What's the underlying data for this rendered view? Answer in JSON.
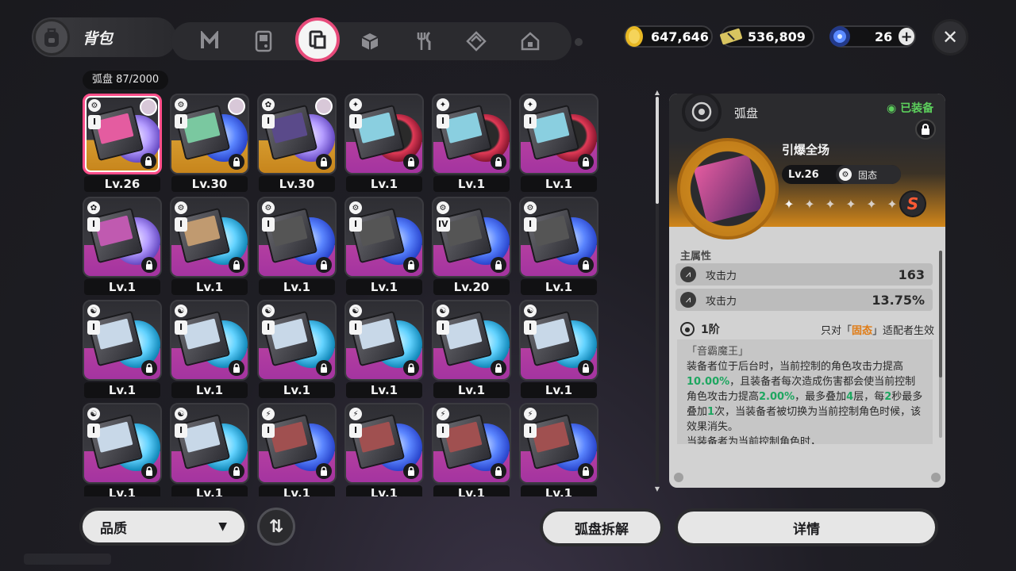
{
  "header": {
    "title": "背包",
    "tabs": [
      {
        "name": "tab-drive",
        "icon": "n-logo-icon"
      },
      {
        "name": "tab-device",
        "icon": "gameboy-icon"
      },
      {
        "name": "tab-disc",
        "icon": "disc-icon",
        "active": true
      },
      {
        "name": "tab-box",
        "icon": "cube-icon"
      },
      {
        "name": "tab-food",
        "icon": "fork-knife-icon"
      },
      {
        "name": "tab-material",
        "icon": "diamond-icon"
      },
      {
        "name": "tab-home",
        "icon": "house-icon"
      }
    ],
    "currencies": [
      {
        "name": "gold-currency",
        "icon": "coin-icon",
        "value": "647,646",
        "color": "#e8b824"
      },
      {
        "name": "ticket-currency",
        "icon": "ticket-icon",
        "value": "536,809",
        "color": "#d8c460"
      },
      {
        "name": "energy-currency",
        "icon": "energy-orb-icon",
        "value": "26",
        "color": "#3a6ae0"
      }
    ]
  },
  "inventory": {
    "count_label": "弧盘 87/2000",
    "cards": [
      {
        "attr": "⚙",
        "rank": "I",
        "level": "Lv.26",
        "quality": "gold",
        "selected": true,
        "avatar": true,
        "disc": "purple",
        "art": "#e45ca0"
      },
      {
        "attr": "⚙",
        "rank": "I",
        "level": "Lv.30",
        "quality": "gold",
        "avatar": true,
        "disc": "blue",
        "art": "#7ac8a0"
      },
      {
        "attr": "✿",
        "rank": "I",
        "level": "Lv.30",
        "quality": "gold",
        "avatar": true,
        "disc": "purple",
        "art": "#5a4a8a"
      },
      {
        "attr": "✦",
        "rank": "I",
        "level": "Lv.1",
        "quality": "purple",
        "disc": "red",
        "art": "#8acfe0"
      },
      {
        "attr": "✦",
        "rank": "I",
        "level": "Lv.1",
        "quality": "purple",
        "disc": "red",
        "art": "#8acfe0"
      },
      {
        "attr": "✦",
        "rank": "I",
        "level": "Lv.1",
        "quality": "purple",
        "disc": "red",
        "art": "#8acfe0"
      },
      {
        "attr": "✿",
        "rank": "I",
        "level": "Lv.1",
        "quality": "purple",
        "disc": "purple",
        "art": "#c05ab0"
      },
      {
        "attr": "⚙",
        "rank": "I",
        "level": "Lv.1",
        "quality": "purple",
        "disc": "teal",
        "art": "#c09a70"
      },
      {
        "attr": "⚙",
        "rank": "I",
        "level": "Lv.1",
        "quality": "purple",
        "disc": "blue",
        "art": "#555"
      },
      {
        "attr": "⚙",
        "rank": "I",
        "level": "Lv.1",
        "quality": "purple",
        "disc": "blue",
        "art": "#555"
      },
      {
        "attr": "⚙",
        "rank": "IV",
        "level": "Lv.20",
        "quality": "purple",
        "disc": "blue",
        "art": "#555"
      },
      {
        "attr": "⚙",
        "rank": "I",
        "level": "Lv.1",
        "quality": "purple",
        "disc": "blue",
        "art": "#555"
      },
      {
        "attr": "☯",
        "rank": "I",
        "level": "Lv.1",
        "quality": "purple",
        "disc": "teal",
        "art": "#c8d8e8"
      },
      {
        "attr": "☯",
        "rank": "I",
        "level": "Lv.1",
        "quality": "purple",
        "disc": "teal",
        "art": "#c8d8e8"
      },
      {
        "attr": "☯",
        "rank": "I",
        "level": "Lv.1",
        "quality": "purple",
        "disc": "teal",
        "art": "#c8d8e8"
      },
      {
        "attr": "☯",
        "rank": "I",
        "level": "Lv.1",
        "quality": "purple",
        "disc": "teal",
        "art": "#c8d8e8"
      },
      {
        "attr": "☯",
        "rank": "I",
        "level": "Lv.1",
        "quality": "purple",
        "disc": "teal",
        "art": "#c8d8e8"
      },
      {
        "attr": "☯",
        "rank": "I",
        "level": "Lv.1",
        "quality": "purple",
        "disc": "teal",
        "art": "#c8d8e8"
      },
      {
        "attr": "☯",
        "rank": "I",
        "level": "Lv.1",
        "quality": "purple",
        "disc": "teal",
        "art": "#c8d8e8"
      },
      {
        "attr": "☯",
        "rank": "I",
        "level": "Lv.1",
        "quality": "purple",
        "disc": "teal",
        "art": "#c8d8e8"
      },
      {
        "attr": "⚡",
        "rank": "I",
        "level": "Lv.1",
        "quality": "purple",
        "disc": "blue",
        "art": "#a05050"
      },
      {
        "attr": "⚡",
        "rank": "I",
        "level": "Lv.1",
        "quality": "purple",
        "disc": "blue",
        "art": "#a05050"
      },
      {
        "attr": "⚡",
        "rank": "I",
        "level": "Lv.1",
        "quality": "purple",
        "disc": "blue",
        "art": "#a05050"
      },
      {
        "attr": "⚡",
        "rank": "I",
        "level": "Lv.1",
        "quality": "purple",
        "disc": "blue",
        "art": "#a05050"
      }
    ]
  },
  "detail": {
    "type_label": "弧盘",
    "equipped_label": "已装备",
    "name": "引爆全场",
    "level": "Lv.26",
    "attribute": "固态",
    "stars_filled": 1,
    "stars_total": 6,
    "rank_badge": "S",
    "main_attr_label": "主属性",
    "stats": [
      {
        "label": "攻击力",
        "value": "163"
      },
      {
        "label": "攻击力",
        "value": "13.75%"
      }
    ],
    "set_tier": "1阶",
    "set_note_prefix": "只对「",
    "set_note_highlight": "固态",
    "set_note_suffix": "」适配者生效",
    "desc": {
      "title": "「音霸魔王」",
      "p1": "装备者位于后台时，当前控制的角色攻击力提高",
      "v1": "10.00%",
      "p2": "，且装备者每次造成伤害都会使当前控制角色攻击力提高",
      "v2": "2.00%",
      "p3": "，最多叠加",
      "v3": "4",
      "p4": "层，每",
      "v4": "2",
      "p5": "秒最多叠加",
      "v5": "1",
      "p6": "次，当装备者被切换为当前控制角色时候，该效果消失。",
      "p7": "当装备者为当前控制角色时，"
    }
  },
  "footer": {
    "quality_label": "品质",
    "sort_label": "⇅",
    "dismantle_label": "弧盘拆解",
    "details_label": "详情"
  }
}
